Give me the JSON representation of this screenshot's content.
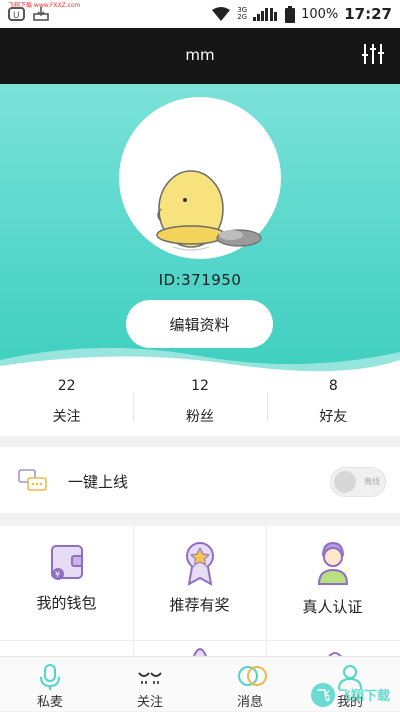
{
  "status_bar": {
    "carrier_tag": "飞翔下载 www.FXXZ.com",
    "network_top": "3G",
    "network_bottom": "2G",
    "battery": "100%",
    "time": "17:27"
  },
  "header": {
    "title": "mm"
  },
  "profile": {
    "id_text": "ID:371950",
    "edit_label": "编辑资料"
  },
  "stats": [
    {
      "value": "22",
      "label": "关注"
    },
    {
      "value": "12",
      "label": "粉丝"
    },
    {
      "value": "8",
      "label": "好友"
    }
  ],
  "online": {
    "label": "一键上线",
    "toggle_text": "离线"
  },
  "grid": [
    {
      "label": "我的钱包",
      "icon": "wallet-icon"
    },
    {
      "label": "推荐有奖",
      "icon": "medal-icon"
    },
    {
      "label": "真人认证",
      "icon": "person-icon"
    }
  ],
  "tabs": [
    {
      "label": "私麦",
      "icon": "microphone-icon"
    },
    {
      "label": "关注",
      "icon": "eyes-icon"
    },
    {
      "label": "消息",
      "icon": "chat-bubbles-icon"
    },
    {
      "label": "我的",
      "icon": "profile-icon"
    }
  ],
  "colors": {
    "accent": "#4ed6c8",
    "purple": "#9b7fd0",
    "header": "#161616"
  }
}
